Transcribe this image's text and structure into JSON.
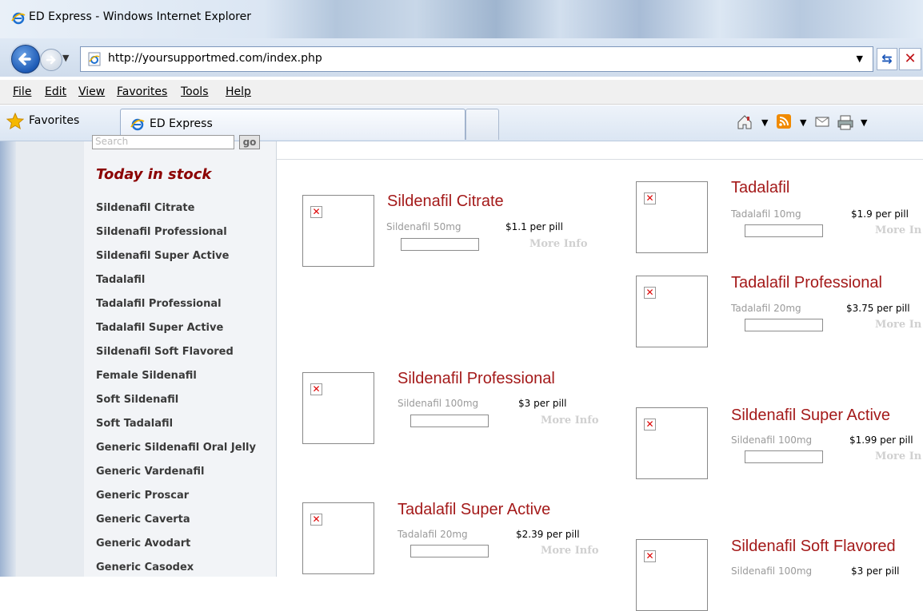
{
  "window": {
    "title": "ED Express - Windows Internet Explorer"
  },
  "address": {
    "url": "http://yoursupportmed.com/index.php"
  },
  "menu": [
    "File",
    "Edit",
    "View",
    "Favorites",
    "Tools",
    "Help"
  ],
  "favorites": {
    "label": "Favorites",
    "tab_label": "ED Express"
  },
  "sidebar": {
    "search_placeholder": "Search",
    "go_label": "go",
    "heading": "Today in stock",
    "items": [
      "Sildenafil Citrate",
      "Sildenafil Professional",
      "Sildenafil Super Active",
      "Tadalafil",
      "Tadalafil Professional",
      "Tadalafil Super Active",
      "Sildenafil Soft Flavored",
      "Female Sildenafil",
      "Soft Sildenafil",
      "Soft Tadalafil",
      "Generic Sildenafil Oral Jelly",
      "Generic Vardenafil",
      "Generic Proscar",
      "Generic Caverta",
      "Generic Avodart",
      "Generic Casodex"
    ]
  },
  "products": [
    {
      "title": "Sildenafil Citrate",
      "dosage": "Sildenafil 50mg",
      "price": "$1.1 per pill",
      "more": "More Info"
    },
    {
      "title": "Tadalafil",
      "dosage": "Tadalafil 10mg",
      "price": "$1.9 per pill",
      "more": "More In"
    },
    {
      "title": "Tadalafil Professional",
      "dosage": "Tadalafil 20mg",
      "price": "$3.75 per pill",
      "more": "More In"
    },
    {
      "title": "Sildenafil Professional",
      "dosage": "Sildenafil 100mg",
      "price": "$3 per pill",
      "more": "More Info"
    },
    {
      "title": "Sildenafil Super Active",
      "dosage": "Sildenafil 100mg",
      "price": "$1.99 per pill",
      "more": "More In"
    },
    {
      "title": "Tadalafil Super Active",
      "dosage": "Tadalafil 20mg",
      "price": "$2.39 per pill",
      "more": "More Info"
    },
    {
      "title": "Sildenafil Soft Flavored",
      "dosage": "Sildenafil 100mg",
      "price": "$3 per pill",
      "more": ""
    }
  ]
}
